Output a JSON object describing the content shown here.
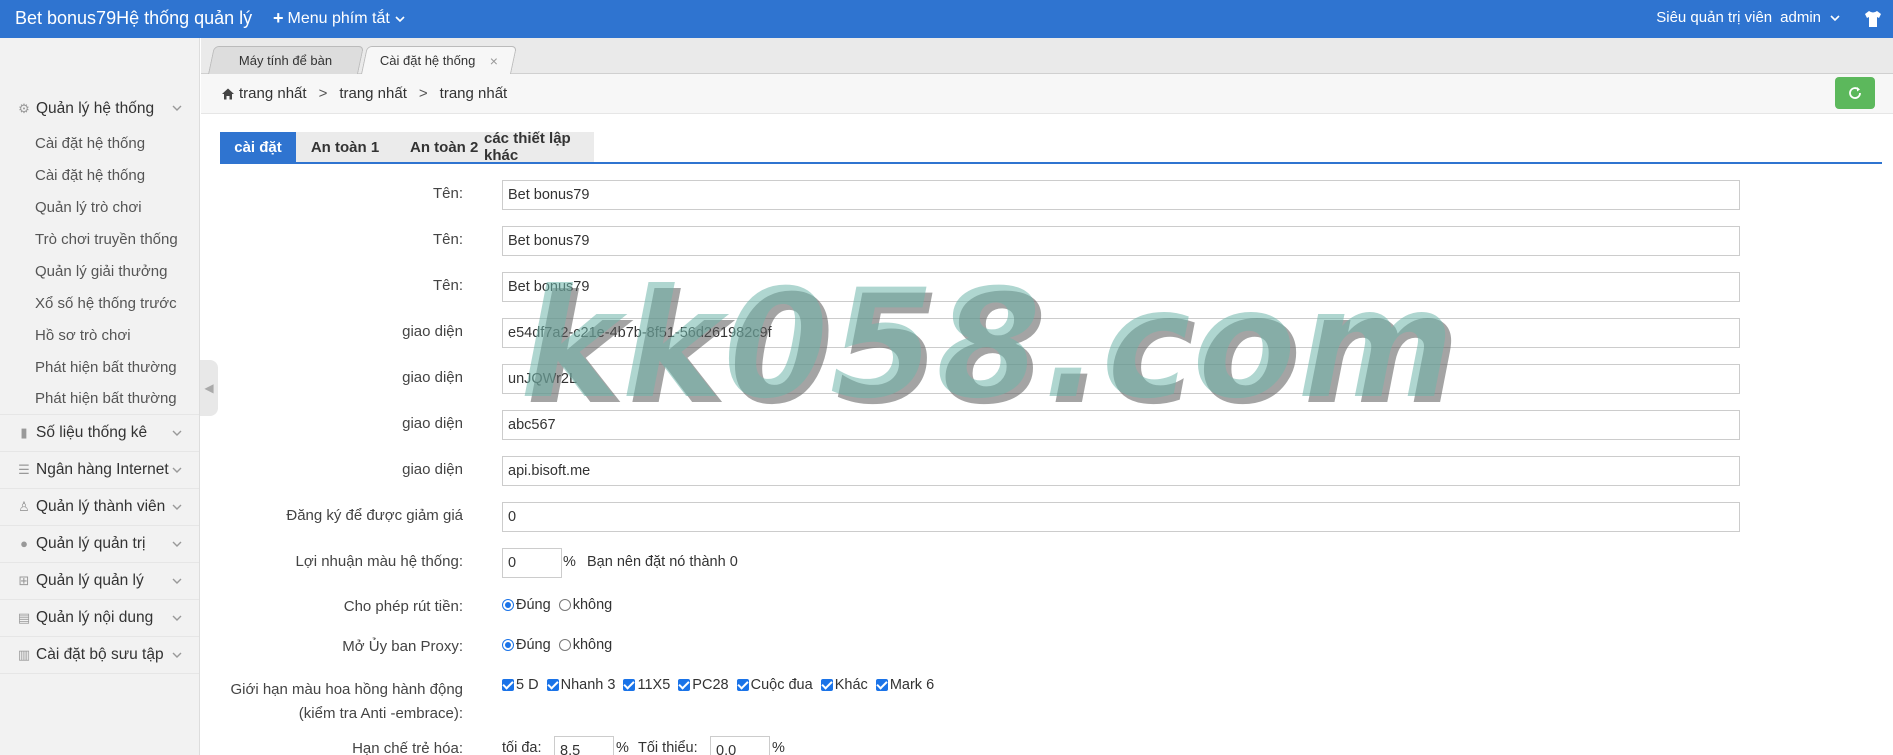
{
  "header": {
    "brand": "Bet bonus79Hệ thống quản lý",
    "menu_shortcut": "Menu phím tắt",
    "role": "Siêu quản trị viên",
    "user": "admin"
  },
  "sidebar": {
    "groups": [
      {
        "label": "Quản lý hệ thống",
        "icon": "gear-icon"
      },
      {
        "label": "Số liệu thống kê",
        "icon": "chart-icon"
      },
      {
        "label": "Ngân hàng Internet",
        "icon": "list-icon"
      },
      {
        "label": "Quản lý thành viên",
        "icon": "user-icon"
      },
      {
        "label": "Quản lý quản trị",
        "icon": "admin-icon"
      },
      {
        "label": "Quản lý quản lý",
        "icon": "grid-icon"
      },
      {
        "label": "Quản lý nội dung",
        "icon": "content-icon"
      },
      {
        "label": "Cài đặt bộ sưu tập",
        "icon": "collection-icon"
      }
    ],
    "sub_items": [
      "Cài đặt hệ thống",
      "Cài đặt hệ thống",
      "Quản lý trò chơi",
      "Trò chơi truyền thống",
      "Quản lý giải thưởng",
      "Xổ số hệ thống trước",
      "Hồ sơ trò chơi",
      "Phát hiện bất thường",
      "Phát hiện bất thường"
    ]
  },
  "tabs": [
    {
      "label": "Máy tính để bàn"
    },
    {
      "label": "Cài đặt hệ thống",
      "close": "×"
    }
  ],
  "breadcrumb": [
    "trang nhất",
    "trang nhất",
    "trang nhất"
  ],
  "breadcrumb_sep": ">",
  "settings_tabs": [
    "cài đặt",
    "An toàn 1",
    "An toàn 2",
    "các thiết lập khác"
  ],
  "form": {
    "rows": [
      {
        "label": "Tên:",
        "value": "Bet bonus79"
      },
      {
        "label": "Tên:",
        "value": "Bet bonus79"
      },
      {
        "label": "Tên:",
        "value": "Bet bonus79"
      },
      {
        "label": "giao diện",
        "value": "e54df7a2-c21e-4b7b-8f51-56d261982c9f"
      },
      {
        "label": "giao diện",
        "value": "unJQWr2L"
      },
      {
        "label": "giao diện",
        "value": "abc567"
      },
      {
        "label": "giao diện",
        "value": "api.bisoft.me"
      },
      {
        "label": "Đăng ký để được giảm giá",
        "value": "0"
      }
    ],
    "profit": {
      "label": "Lợi nhuận màu hệ thống:",
      "value": "0",
      "unit": "%",
      "hint": "Bạn nên đặt nó thành 0"
    },
    "withdraw": {
      "label": "Cho phép rút tiền:",
      "yes": "Đúng",
      "no": "không",
      "selected": "yes"
    },
    "proxy": {
      "label": "Mở Ủy ban Proxy:",
      "yes": "Đúng",
      "no": "không",
      "selected": "yes"
    },
    "anti_embrace": {
      "label_line1": "Giới hạn màu hoa hồng hành động",
      "label_line2": "(kiểm tra Anti -embrace):",
      "options": [
        "5 D",
        "Nhanh 3",
        "11X5",
        "PC28",
        "Cuộc đua",
        "Khác",
        "Mark 6"
      ]
    },
    "rejuvenation": {
      "label": "Hạn chế trẻ hóa:",
      "max_label": "tối đa:",
      "max_value": "8.5",
      "min_label": "Tối thiểu:",
      "min_value": "0.0",
      "unit": "%"
    }
  },
  "watermark": "kk058.com"
}
